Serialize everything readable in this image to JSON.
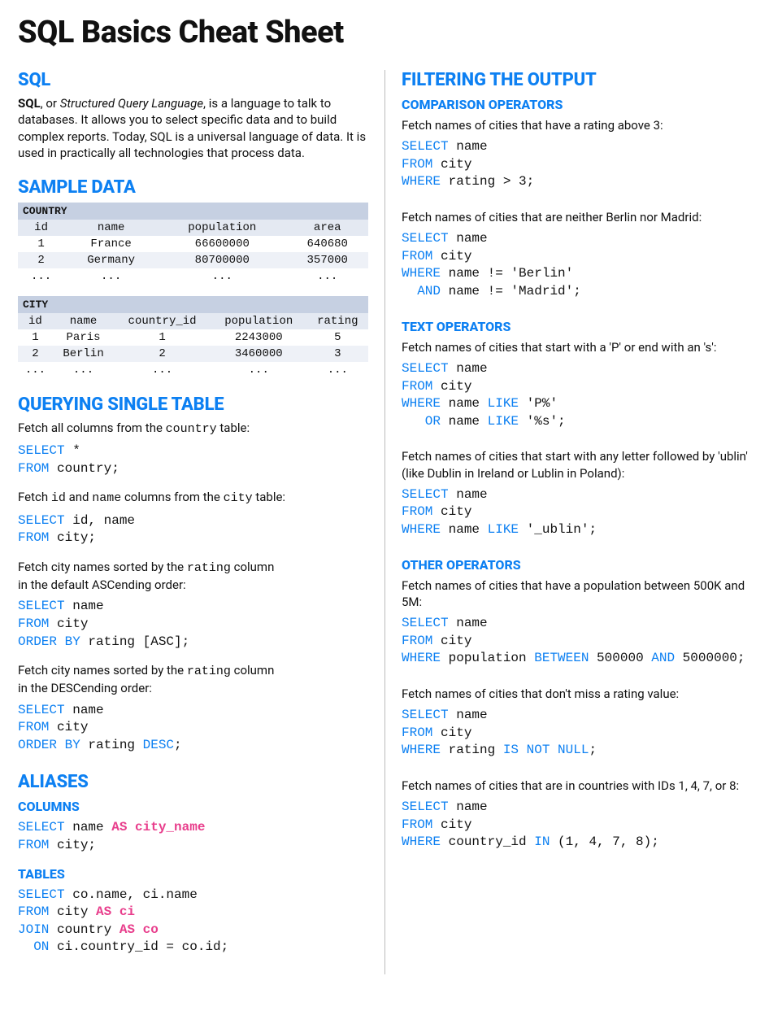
{
  "title": "SQL Basics Cheat Sheet",
  "left": {
    "sql": {
      "heading": "SQL",
      "intro_pre": "SQL",
      "intro_mid": ", or ",
      "intro_em": "Structured Query Language",
      "intro_post": ", is a language to talk to databases. It allows you to select specific data and to build complex reports. Today, SQL is a universal language of data. It is used in practically all technologies that process data."
    },
    "sample": {
      "heading": "SAMPLE DATA",
      "country": {
        "label": "COUNTRY",
        "headers": [
          "id",
          "name",
          "population",
          "area"
        ],
        "rows": [
          [
            "1",
            "France",
            "66600000",
            "640680"
          ],
          [
            "2",
            "Germany",
            "80700000",
            "357000"
          ],
          [
            "...",
            "...",
            "...",
            "..."
          ]
        ]
      },
      "city": {
        "label": "CITY",
        "headers": [
          "id",
          "name",
          "country_id",
          "population",
          "rating"
        ],
        "rows": [
          [
            "1",
            "Paris",
            "1",
            "2243000",
            "5"
          ],
          [
            "2",
            "Berlin",
            "2",
            "3460000",
            "3"
          ],
          [
            "...",
            "...",
            "...",
            "...",
            "..."
          ]
        ]
      }
    },
    "query": {
      "heading": "QUERYING SINGLE TABLE",
      "d1_pre": "Fetch all columns from the ",
      "d1_code": "country",
      "d1_post": " table:",
      "c1": {
        "select": "SELECT",
        "star": " *",
        "from": "FROM",
        "table": " country;"
      },
      "d2_pre": "Fetch ",
      "d2_code1": "id",
      "d2_mid": " and ",
      "d2_code2": "name",
      "d2_mid2": " columns from the ",
      "d2_code3": "city",
      "d2_post": " table:",
      "c2": {
        "select": "SELECT",
        "cols": " id, name",
        "from": "FROM",
        "table": " city;"
      },
      "d3_pre": "Fetch city names sorted by the ",
      "d3_code": "rating",
      "d3_post": " column",
      "d3_line2": "in the default ASCending order:",
      "c3": {
        "select": "SELECT",
        "cols": " name",
        "from": "FROM",
        "table": " city",
        "orderby": "ORDER BY",
        "rest": " rating [ASC];"
      },
      "d4_pre": "Fetch city names sorted by the ",
      "d4_code": "rating",
      "d4_post": " column",
      "d4_line2": "in the DESCending order:",
      "c4": {
        "select": "SELECT",
        "cols": " name",
        "from": "FROM",
        "table": " city",
        "orderby": "ORDER BY",
        "rest": " rating ",
        "desc": "DESC",
        "semi": ";"
      }
    },
    "aliases": {
      "heading": "ALIASES",
      "columns_h": "COLUMNS",
      "c1": {
        "select": "SELECT",
        "cols": " name ",
        "as": "AS city_name",
        "from": "FROM",
        "table": " city;"
      },
      "tables_h": "TABLES",
      "c2": {
        "select": "SELECT",
        "cols": " co.name, ci.name",
        "from": "FROM",
        "t1": " city ",
        "as1": "AS ci",
        "join": "JOIN",
        "t2": " country ",
        "as2": "AS co",
        "on": "  ON",
        "cond": " ci.country_id = co.id;"
      }
    }
  },
  "right": {
    "filtering_h": "FILTERING THE OUTPUT",
    "comp_h": "COMPARISON OPERATORS",
    "d1": "Fetch names of cities that have a rating above 3:",
    "c1": {
      "select": "SELECT",
      "cols": " name",
      "from": "FROM",
      "table": " city",
      "where": "WHERE",
      "cond": " rating > 3;"
    },
    "d2": "Fetch names of cities that are neither Berlin nor Madrid:",
    "c2": {
      "select": "SELECT",
      "cols": " name",
      "from": "FROM",
      "table": " city",
      "where": "WHERE",
      "cond1": " name != 'Berlin'",
      "and": "  AND",
      "cond2": " name != 'Madrid';"
    },
    "text_h": "TEXT OPERATORS",
    "d3": "Fetch names of cities that start with a 'P' or end with an 's':",
    "c3": {
      "select": "SELECT",
      "cols": " name",
      "from": "FROM",
      "table": " city",
      "where": "WHERE",
      "n1": " name ",
      "like": "LIKE",
      "p1": " 'P%'",
      "or": "   OR",
      "n2": " name ",
      "p2": " '%s';"
    },
    "d4": "Fetch names of cities that start with any letter followed by 'ublin' (like Dublin in Ireland or Lublin in Poland):",
    "c4": {
      "select": "SELECT",
      "cols": " name",
      "from": "FROM",
      "table": " city",
      "where": "WHERE",
      "n": " name ",
      "like": "LIKE",
      "p": " '_ublin';"
    },
    "other_h": "OTHER OPERATORS",
    "d5": "Fetch names of cities that have a population between 500K and 5M:",
    "c5": {
      "select": "SELECT",
      "cols": " name",
      "from": "FROM",
      "table": " city",
      "where": "WHERE",
      "n": " population ",
      "between": "BETWEEN",
      "v1": " 500000 ",
      "and": "AND",
      "v2": " 5000000;"
    },
    "d6": "Fetch names of cities that don't miss a rating value:",
    "c6": {
      "select": "SELECT",
      "cols": " name",
      "from": "FROM",
      "table": " city",
      "where": "WHERE",
      "n": " rating ",
      "isnn": "IS NOT NULL",
      "semi": ";"
    },
    "d7": "Fetch names of cities that are in countries with IDs 1, 4, 7, or 8:",
    "c7": {
      "select": "SELECT",
      "cols": " name",
      "from": "FROM",
      "table": " city",
      "where": "WHERE",
      "n": " country_id ",
      "in": "IN",
      "v": " (1, 4, 7, 8);"
    }
  }
}
